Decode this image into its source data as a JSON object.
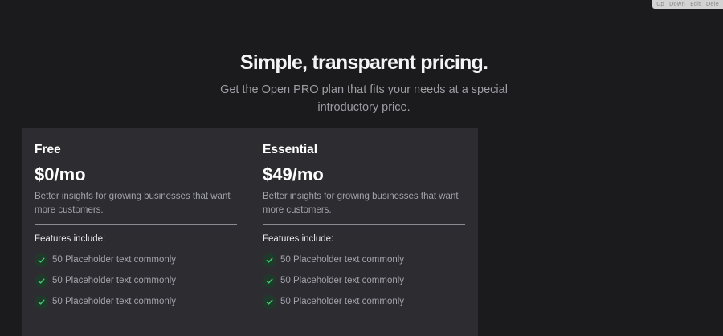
{
  "toolbar": {
    "buttons": [
      {
        "label": "Up"
      },
      {
        "label": "Down"
      },
      {
        "label": "Edit"
      },
      {
        "label": "Dele"
      }
    ]
  },
  "header": {
    "title": "Simple, transparent pricing.",
    "subtitle": "Get the Open PRO plan that fits your needs at a special introductory price."
  },
  "plans": [
    {
      "name": "Free",
      "price": "$0/mo",
      "description": "Better insights for growing businesses that want more customers.",
      "features_heading": "Features include:",
      "features": [
        "50 Placeholder text commonly",
        "50 Placeholder text commonly",
        "50 Placeholder text commonly"
      ]
    },
    {
      "name": "Essential",
      "price": "$49/mo",
      "description": "Better insights for growing businesses that want more customers.",
      "features_heading": "Features include:",
      "features": [
        "50 Placeholder text commonly",
        "50 Placeholder text commonly",
        "50 Placeholder text commonly"
      ]
    }
  ],
  "colors": {
    "background": "#1b1b1d",
    "panel": "#2d2d31",
    "check_accent": "#3ecf6e",
    "check_background": "#1f3a2a",
    "muted_text": "#a2a2aa"
  },
  "icons": {
    "feature_bullet": "checkmark-icon"
  }
}
